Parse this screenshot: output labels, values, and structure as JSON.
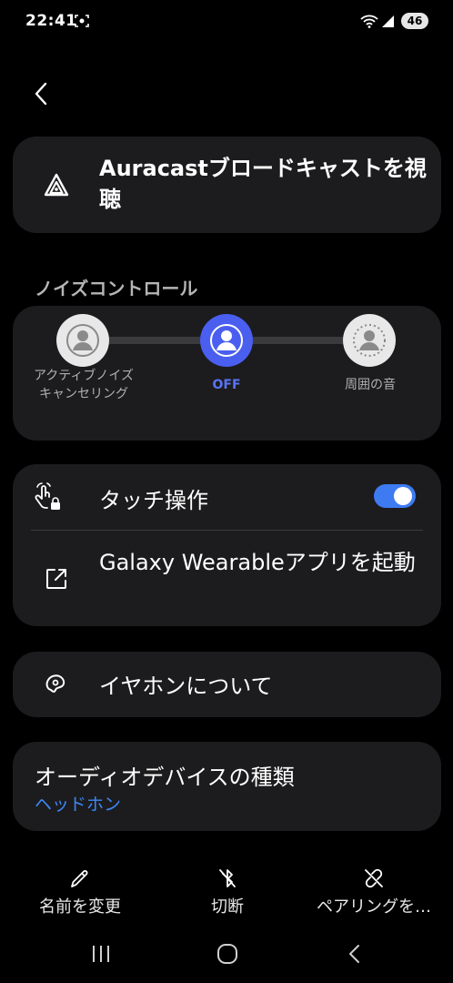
{
  "status_bar": {
    "time": "22:41",
    "battery": "46"
  },
  "auracast": {
    "label": "Auracastブロードキャストを視聴"
  },
  "noise_control": {
    "title": "ノイズコントロール",
    "options": [
      {
        "label": "アクティブノイズキャンセリング"
      },
      {
        "label": "OFF"
      },
      {
        "label": "周囲の音"
      }
    ],
    "selected": "OFF"
  },
  "touch_controls": {
    "label": "タッチ操作",
    "enabled": true
  },
  "galaxy_wearable": {
    "label": "Galaxy Wearableアプリを起動"
  },
  "about_earbuds": {
    "label": "イヤホンについて"
  },
  "audio_device_type": {
    "title": "オーディオデバイスの種類",
    "value": "ヘッドホン"
  },
  "bottom_actions": [
    {
      "label": "名前を変更",
      "icon": "pencil-icon"
    },
    {
      "label": "切断",
      "icon": "bluetooth-off-icon"
    },
    {
      "label": "ペアリングを…",
      "icon": "unlink-icon"
    }
  ],
  "colors": {
    "accent": "#4a5ff0",
    "toggle": "#3e7bf2",
    "link": "#3c87f6",
    "card": "#1c1c1e"
  }
}
